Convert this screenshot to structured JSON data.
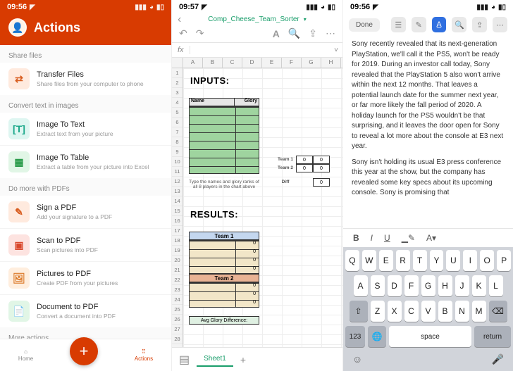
{
  "status": {
    "time": "09:56",
    "compass": "◤"
  },
  "status2": {
    "time": "09:57"
  },
  "panel1": {
    "title": "Actions",
    "sections": {
      "share": {
        "label": "Share files",
        "items": [
          {
            "title": "Transfer Files",
            "sub": "Share files from your computer to phone"
          }
        ]
      },
      "convert": {
        "label": "Convert text in images",
        "items": [
          {
            "title": "Image To Text",
            "sub": "Extract text from your picture"
          },
          {
            "title": "Image To Table",
            "sub": "Extract a table from your picture into Excel"
          }
        ]
      },
      "pdf": {
        "label": "Do more with PDFs",
        "items": [
          {
            "title": "Sign a PDF",
            "sub": "Add your signature to a PDF"
          },
          {
            "title": "Scan to PDF",
            "sub": "Scan pictures into PDF"
          },
          {
            "title": "Pictures to PDF",
            "sub": "Create PDF from your pictures"
          },
          {
            "title": "Document to PDF",
            "sub": "Convert a document into PDF"
          }
        ]
      },
      "more": {
        "label": "More actions"
      }
    },
    "nav": {
      "home": "Home",
      "actions": "Actions"
    }
  },
  "panel2": {
    "filename": "Comp_Cheese_Team_Sorter",
    "fx": "fx",
    "cols": [
      "A",
      "B",
      "C",
      "D",
      "E",
      "F",
      "G",
      "H"
    ],
    "inputs_label": "INPUTS:",
    "results_label": "RESULTS:",
    "th_name": "Name",
    "th_glory": "Glory",
    "hint": "Type the names and glory ranks of all 8 players in the chart above",
    "team1_label": "Team 1",
    "team2_label": "Team 2",
    "diff_label": "Diff",
    "avg_label": "Avg Glory Difference:",
    "team_values": {
      "t1": [
        "0",
        "0"
      ],
      "t2": [
        "0",
        "0"
      ],
      "diff": "0"
    },
    "results_rows": {
      "team1": [
        "0",
        "0",
        "0",
        "0"
      ],
      "team2": [
        "0",
        "0",
        "0"
      ]
    },
    "sheet_tab": "Sheet1"
  },
  "panel3": {
    "done": "Done",
    "para1": "Sony recently revealed that its next-generation PlayStation, we'll call it the PS5, won't be ready for 2019. During an investor call today, Sony revealed that the PlayStation 5 also won't arrive within the next 12 months. That leaves a potential launch date for the summer next year, or far more likely the fall period of 2020. A holiday launch for the PS5 wouldn't be that surprising, and it leaves the door open for Sony to reveal a lot more about the console at E3 next year.",
    "para2": "Sony isn't holding its usual E3 press conference this year at the show, but the company has revealed some key specs about its upcoming console. Sony is promising that",
    "fmt": {
      "bold": "B",
      "italic": "I",
      "underline": "U"
    },
    "keys": {
      "r1": [
        "Q",
        "W",
        "E",
        "R",
        "T",
        "Y",
        "U",
        "I",
        "O",
        "P"
      ],
      "r2": [
        "A",
        "S",
        "D",
        "F",
        "G",
        "H",
        "J",
        "K",
        "L"
      ],
      "r3": [
        "Z",
        "X",
        "C",
        "V",
        "B",
        "N",
        "M"
      ],
      "num": "123",
      "space": "space",
      "return": "return"
    }
  }
}
